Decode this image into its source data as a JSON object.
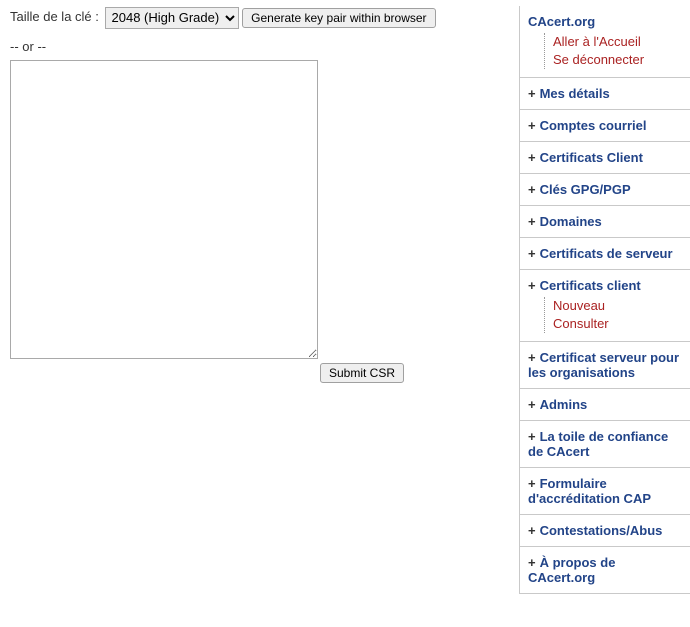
{
  "main": {
    "key_size_label": "Taille de la clé :",
    "key_size_selected": "2048 (High Grade)",
    "generate_button": "Generate key pair within browser",
    "or_text": "-- or --",
    "csr_value": "",
    "submit_button": "Submit CSR"
  },
  "sidebar": {
    "brand": "CAcert.org",
    "brand_links": [
      "Aller à l'Accueil",
      "Se déconnecter"
    ],
    "sections": [
      {
        "title": "Mes détails",
        "links": []
      },
      {
        "title": "Comptes courriel",
        "links": []
      },
      {
        "title": "Certificats Client",
        "links": []
      },
      {
        "title": "Clés GPG/PGP",
        "links": []
      },
      {
        "title": "Domaines",
        "links": []
      },
      {
        "title": "Certificats de serveur",
        "links": []
      },
      {
        "title": "Certificats client",
        "links": [
          "Nouveau",
          "Consulter"
        ]
      },
      {
        "title": "Certificat serveur pour les organisations",
        "links": []
      },
      {
        "title": "Admins",
        "links": []
      },
      {
        "title": "La toile de confiance de CAcert",
        "links": []
      },
      {
        "title": "Formulaire d'accréditation CAP",
        "links": []
      },
      {
        "title": "Contestations/Abus",
        "links": []
      },
      {
        "title": "À propos de CAcert.org",
        "links": []
      }
    ]
  }
}
